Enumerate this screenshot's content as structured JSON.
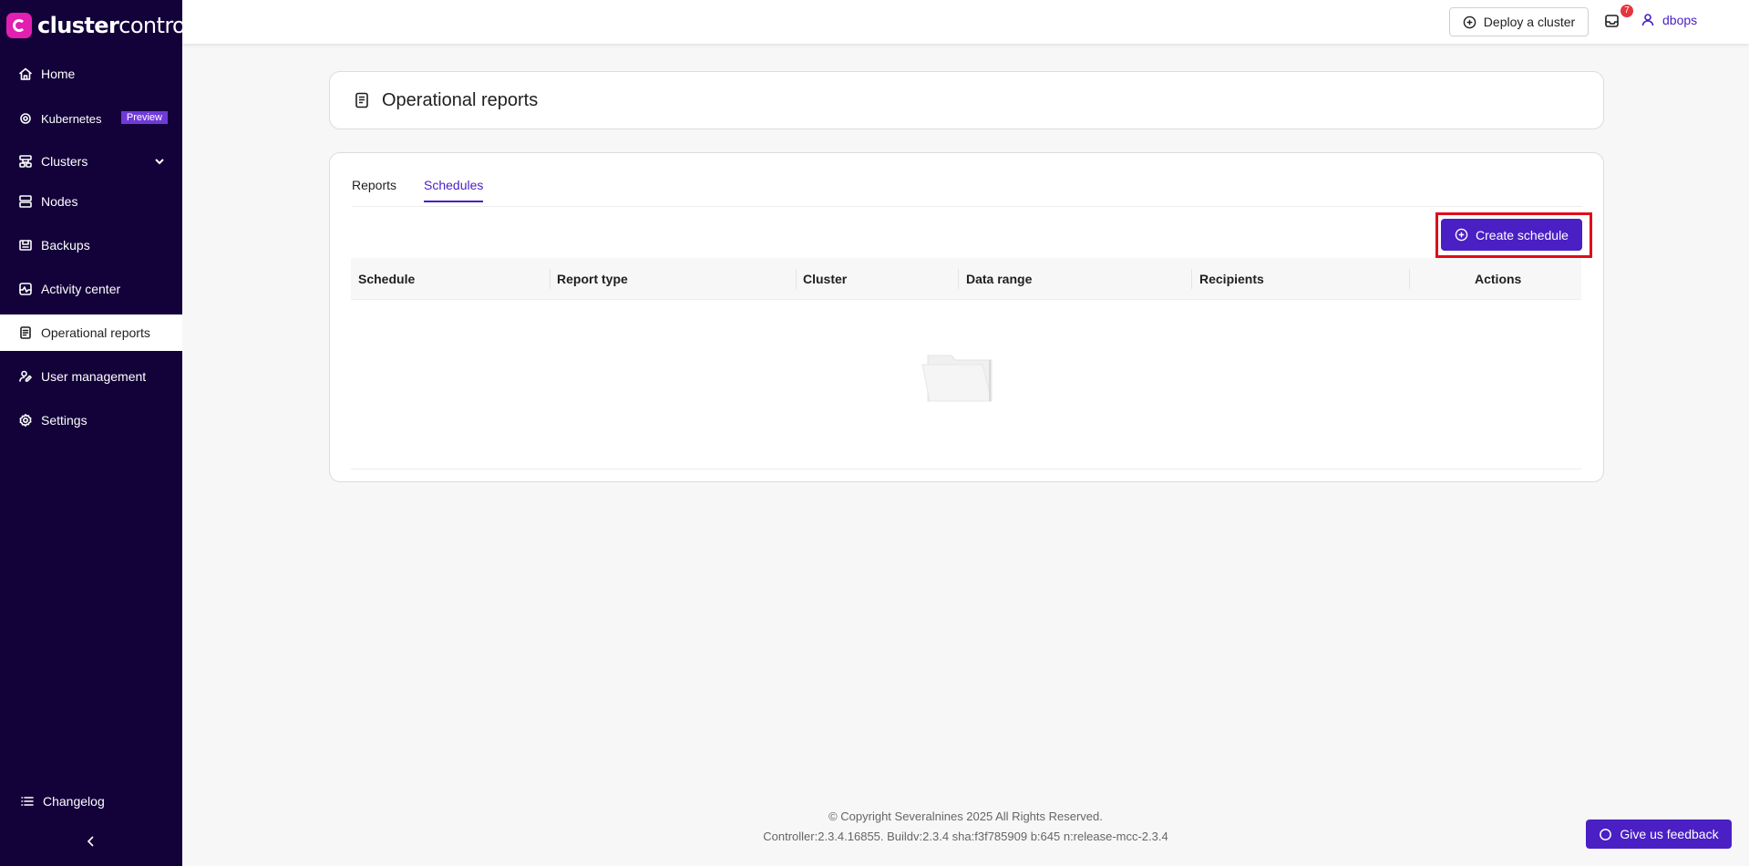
{
  "app": {
    "logo_bold": "cluster",
    "logo_regular": "control"
  },
  "sidebar": {
    "items": [
      {
        "label": "Home",
        "icon": "home-icon"
      },
      {
        "label": "Kubernetes",
        "icon": "kubernetes-icon",
        "badge": "Preview"
      },
      {
        "label": "Clusters",
        "icon": "clusters-icon",
        "expandable": true
      },
      {
        "label": "Nodes",
        "icon": "nodes-icon"
      },
      {
        "label": "Backups",
        "icon": "backups-icon"
      },
      {
        "label": "Activity center",
        "icon": "activity-icon"
      },
      {
        "label": "Operational reports",
        "icon": "reports-icon",
        "active": true
      },
      {
        "label": "User management",
        "icon": "users-icon"
      },
      {
        "label": "Settings",
        "icon": "gear-icon"
      }
    ],
    "changelog_label": "Changelog"
  },
  "topbar": {
    "deploy_label": "Deploy a cluster",
    "notification_count": "7",
    "username": "dbops"
  },
  "page": {
    "title": "Operational reports",
    "tabs": [
      {
        "label": "Reports",
        "active": false
      },
      {
        "label": "Schedules",
        "active": true
      }
    ],
    "create_label": "Create schedule",
    "columns": [
      "Schedule",
      "Report type",
      "Cluster",
      "Data range",
      "Recipients",
      "Actions"
    ]
  },
  "footer": {
    "copyright": "© Copyright Severalnines 2025 All Rights Reserved.",
    "build": "Controller:2.3.4.16855. Buildv:2.3.4 sha:f3f785909 b:645 n:release-mcc-2.3.4",
    "feedback_label": "Give us feedback"
  },
  "colors": {
    "sidebar_bg": "#13013a",
    "accent": "#4a1fc4",
    "brand": "#e11fb0",
    "highlight_border": "#e00d1a"
  }
}
